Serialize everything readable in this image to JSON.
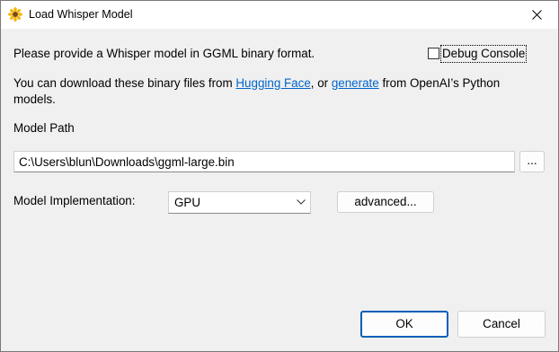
{
  "window": {
    "title": "Load Whisper Model",
    "icon": "sunflower-icon",
    "close_icon": "close-icon"
  },
  "intro": {
    "text": "Please provide a Whisper model in GGML binary format."
  },
  "debug_console": {
    "label": "Debug Console",
    "checked": false
  },
  "download_info": {
    "prefix": "You can download these binary files from ",
    "link_hugging_face": "Hugging Face",
    "middle": ", or ",
    "link_generate": "generate",
    "suffix": " from OpenAI’s Python",
    "line2": "models."
  },
  "model_path": {
    "label": "Model Path",
    "value": "C:\\Users\\blun\\Downloads\\ggml-large.bin",
    "browse_label": "..."
  },
  "implementation": {
    "label": "Model Implementation:",
    "selected": "GPU",
    "advanced_label": "advanced..."
  },
  "buttons": {
    "ok": "OK",
    "cancel": "Cancel"
  },
  "colors": {
    "link": "#0066cc",
    "default_button_border": "#005fb8",
    "dialog_bg": "#f0f0f0"
  }
}
